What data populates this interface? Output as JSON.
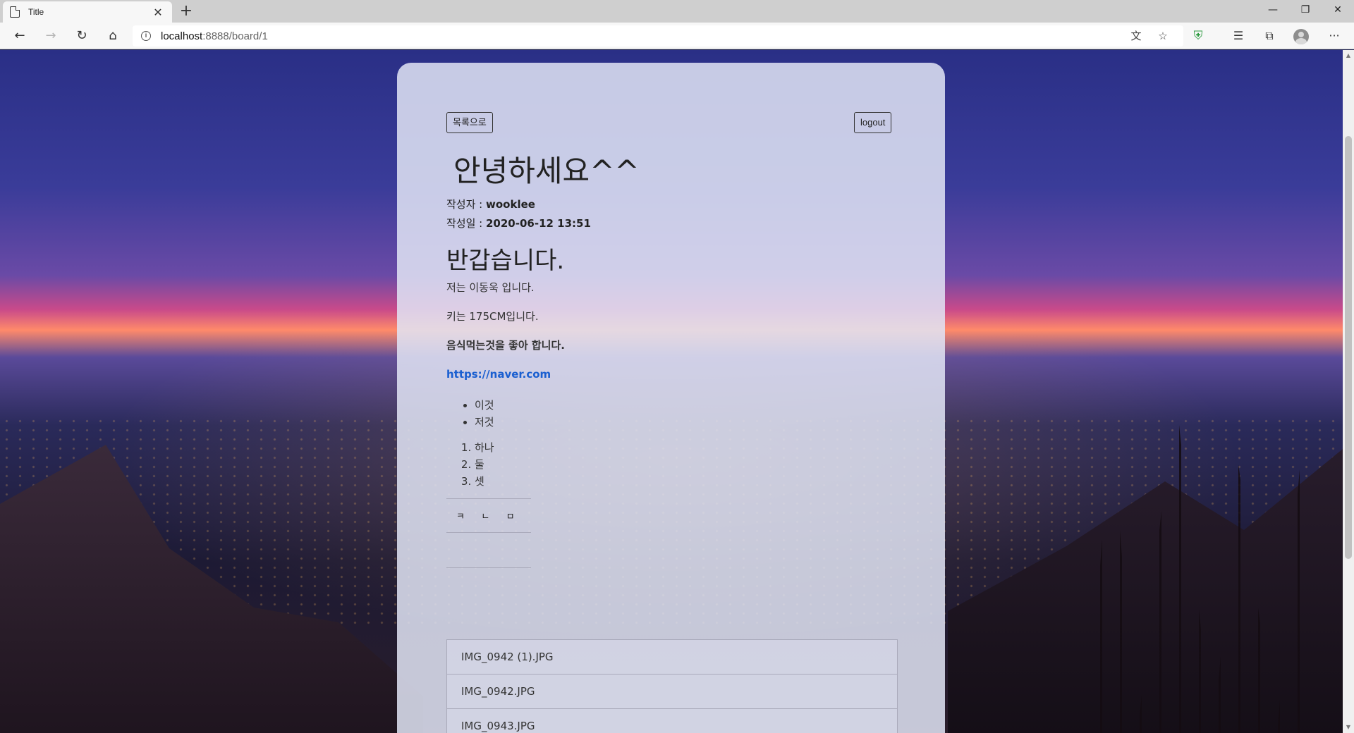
{
  "browser": {
    "tab_title": "Title",
    "url_host": "localhost",
    "url_rest": ":8888/board/1"
  },
  "page": {
    "back_to_list": "목록으로",
    "logout": "logout",
    "title": "안녕하세요^^",
    "author_label": "작성자 : ",
    "author": "wooklee",
    "date_label": "작성일 : ",
    "date": "2020-06-12 13:51"
  },
  "content": {
    "heading": "반갑습니다.",
    "paragraphs": [
      "저는 이동욱 입니다.",
      "키는 175CM입니다."
    ],
    "bold_paragraph": "음식먹는것을 좋아 합니다.",
    "link": "https://naver.com",
    "bullets": [
      "이것",
      "저것"
    ],
    "numbered": [
      "하나",
      "둘",
      "셋"
    ],
    "table_row": [
      "ㅋ",
      "ㄴ",
      "ㅁ"
    ]
  },
  "files": [
    "IMG_0942 (1).JPG",
    "IMG_0942.JPG",
    "IMG_0943.JPG"
  ],
  "colors": {
    "link": "#1a5fd0",
    "shield": "#2b9a3f"
  }
}
